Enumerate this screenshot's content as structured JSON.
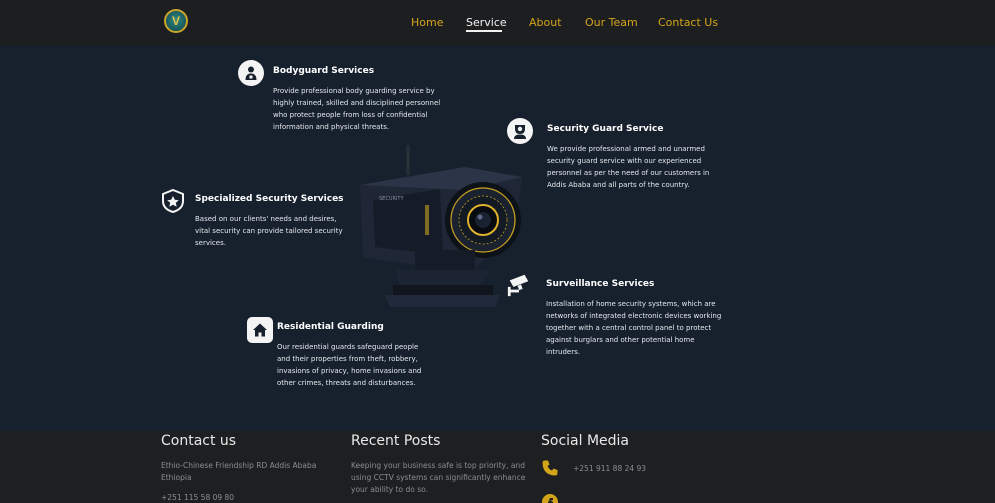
{
  "nav": {
    "items": [
      {
        "label": "Home"
      },
      {
        "label": "Service"
      },
      {
        "label": "About"
      },
      {
        "label": "Our Team"
      },
      {
        "label": "Contact Us"
      }
    ],
    "active": "Service"
  },
  "services": [
    {
      "title": "Bodyguard Services",
      "icon": "person-badge-icon",
      "description": "Provide professional body guarding service by highly trained, skilled and disciplined personnel who protect people from loss of confidential information and physical threats."
    },
    {
      "title": "Security Guard Service",
      "icon": "guard-icon",
      "description": "We provide professional armed and unarmed security guard service with our experienced personnel as per the need of our customers in Addis Ababa and all parts of the country."
    },
    {
      "title": "Specialized Security Services",
      "icon": "police-badge-icon",
      "description": "Based on our clients' needs and desires, vital security can provide tailored security services."
    },
    {
      "title": "Surveillance Services",
      "icon": "cctv-camera-icon",
      "description": "Installation of home security systems, which are networks of integrated electronic devices working together with a central control panel to protect against burglars and other potential home intruders."
    },
    {
      "title": "Residential Guarding",
      "icon": "house-icon",
      "description": "Our residential guards safeguard people and their properties from theft, robbery, invasions of privacy, home invasions and other crimes, threats and disturbances."
    }
  ],
  "camera_brand": "SECURITY",
  "footer": {
    "contact": {
      "heading": "Contact us",
      "address": "Ethio-Chinese Friendship RD Addis Ababa Ethiopia",
      "phone": "+251 115 58 09 80"
    },
    "posts": {
      "heading": "Recent Posts",
      "text": "Keeping your business safe is top priority, and using CCTV systems can significantly enhance your ability to do so."
    },
    "social": {
      "heading": "Social Media",
      "phone": "+251 911 88 24 93"
    }
  },
  "colors": {
    "accent": "#d3a41a",
    "hero_bg": "#17202d",
    "nav_bg": "#1d1e20",
    "footer_bg": "#1e1f21"
  }
}
